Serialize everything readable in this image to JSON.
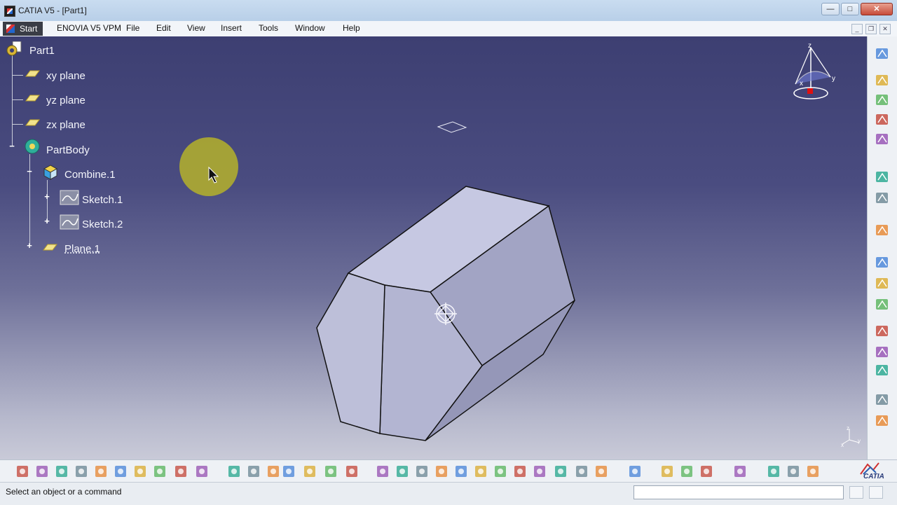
{
  "window": {
    "title": "CATIA V5 - [Part1]",
    "min_glyph": "—",
    "max_glyph": "□",
    "close_glyph": "✕"
  },
  "menu": {
    "items": [
      "Start",
      "ENOVIA V5 VPM",
      "File",
      "Edit",
      "View",
      "Insert",
      "Tools",
      "Window",
      "Help"
    ]
  },
  "tree": {
    "root": "Part1",
    "planes": [
      "xy plane",
      "yz plane",
      "zx plane"
    ],
    "body": "PartBody",
    "combine": "Combine.1",
    "sketches": [
      "Sketch.1",
      "Sketch.2"
    ],
    "plane1": "Plane.1"
  },
  "compass": {
    "x": "x",
    "y": "y",
    "z": "z"
  },
  "status": {
    "message": "Select an object or a command",
    "command_value": ""
  },
  "brand": "CATIA",
  "icons": {
    "right_toolbar": [
      "sketcher-icon",
      "part-body-icon",
      "solid-icon",
      "volume-icon",
      "surface-icon",
      "select-icon",
      "snap-icon",
      "sketch-tool-icon",
      "point-icon",
      "line-icon",
      "plane-icon",
      "extrude-icon",
      "sweep-icon",
      "fill-icon",
      "circle-icon",
      "spline-icon"
    ],
    "bottom_toolbar": [
      "new-icon",
      "open-icon",
      "save-icon",
      "print-icon",
      "cut-icon",
      "copy-icon",
      "paste-icon",
      "undo-icon",
      "redo-icon",
      "whats-this-icon",
      "formula-icon",
      "annotation-icon",
      "link-icon",
      "table-icon",
      "graph-icon",
      "measure-icon",
      "analysis-icon",
      "fly-mode-icon",
      "fit-all-icon",
      "pan-icon",
      "rotate-icon",
      "zoom-in-icon",
      "zoom-out-icon",
      "normal-view-icon",
      "multi-view-icon",
      "iso-view-icon",
      "shading-icon",
      "wireframe-icon",
      "render-icon",
      "swap-icon",
      "catalog-icon",
      "hide-icon",
      "capture-icon",
      "reframe-icon",
      "manipulate-icon",
      "axis-icon",
      "spec-tree-icon"
    ]
  },
  "colors": {
    "bg_top": "#3d3f72",
    "bg_bottom": "#c9cad8",
    "solid_light": "#c8cae4",
    "solid_mid": "#aeb0cf",
    "solid_dark": "#9597bb",
    "highlight": "#b5b12a"
  }
}
